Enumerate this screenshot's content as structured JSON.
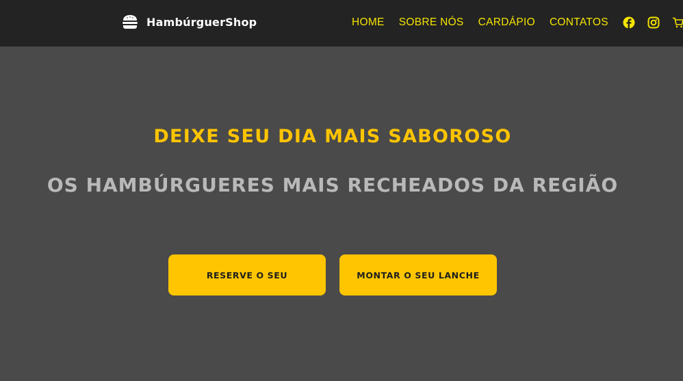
{
  "header": {
    "brand_name": "HambúrguerShop",
    "brand_icon": "burger-icon",
    "nav_items": [
      {
        "label": "HOME"
      },
      {
        "label": "SOBRE NÓS"
      },
      {
        "label": "CARDÁPIO"
      },
      {
        "label": "CONTATOS"
      }
    ],
    "social_icons": [
      "facebook-icon",
      "instagram-icon",
      "cart-icon"
    ]
  },
  "hero": {
    "title": "DEIXE SEU DIA MAIS SABOROSO",
    "subtitle": "OS HAMBÚRGUERES MAIS RECHEADOS DA REGIÃO",
    "buttons": [
      {
        "label": "RESERVE O SEU"
      },
      {
        "label": "MONTAR O SEU LANCHE"
      }
    ]
  },
  "colors": {
    "navbar_bg": "#232323",
    "page_bg": "#4a4a4a",
    "nav_text": "#f5e400",
    "accent": "#ffc400",
    "subtitle_text": "#b9b9b9",
    "button_text": "#1e1e1e"
  }
}
